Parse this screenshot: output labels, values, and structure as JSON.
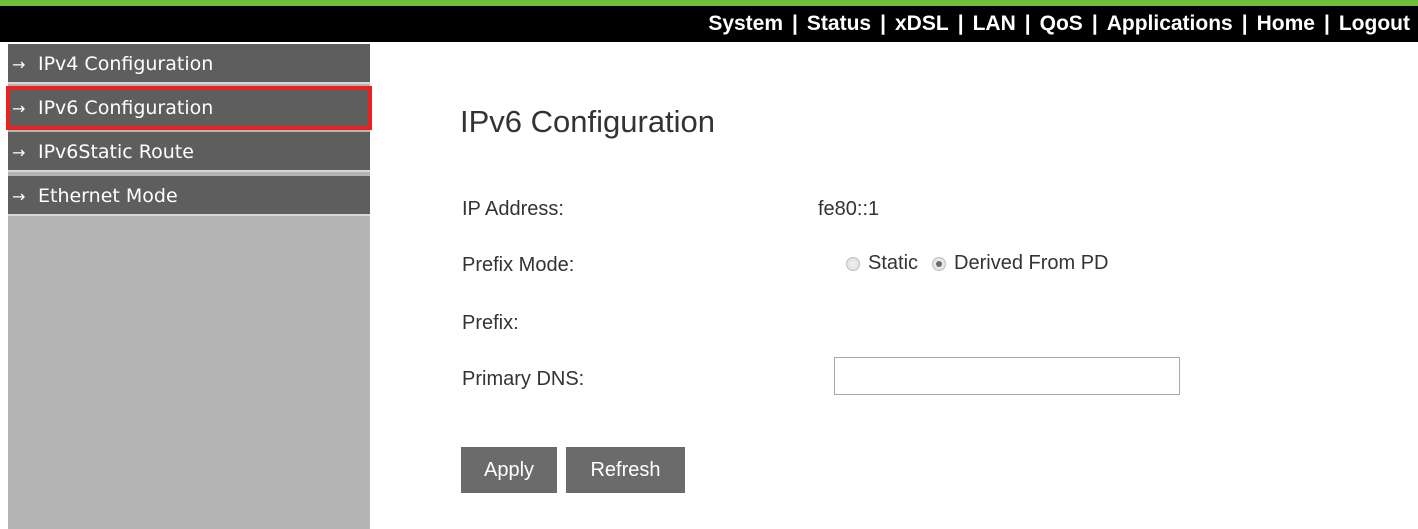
{
  "topnav": {
    "items": [
      "System",
      "Status",
      "xDSL",
      "LAN",
      "QoS",
      "Applications",
      "Home",
      "Logout"
    ],
    "separator": "|"
  },
  "sidebar": {
    "arrow": "→",
    "items": [
      {
        "label": "IPv4 Configuration",
        "selected": false
      },
      {
        "label": "IPv6 Configuration",
        "selected": true
      },
      {
        "label": "IPv6Static Route",
        "selected": false
      },
      {
        "label": "Ethernet Mode",
        "selected": false
      }
    ]
  },
  "main": {
    "title": "IPv6 Configuration",
    "ip_address": {
      "label": "IP Address:",
      "value": "fe80::1"
    },
    "prefix_mode": {
      "label": "Prefix Mode:",
      "options": [
        {
          "label": "Static",
          "checked": false
        },
        {
          "label": "Derived From PD",
          "checked": true
        }
      ]
    },
    "prefix": {
      "label": "Prefix:",
      "value": ""
    },
    "primary_dns": {
      "label": "Primary DNS:",
      "value": "",
      "placeholder": ""
    },
    "buttons": {
      "apply": "Apply",
      "refresh": "Refresh"
    }
  },
  "colors": {
    "nav_bg": "#000000",
    "top_stripe": "#6fbf3a",
    "sidebar_item_bg": "#5e5e5e",
    "sidebar_bg": "#b4b4b4",
    "selected_outline": "#e8231f",
    "button_bg": "#6b6b6b"
  }
}
